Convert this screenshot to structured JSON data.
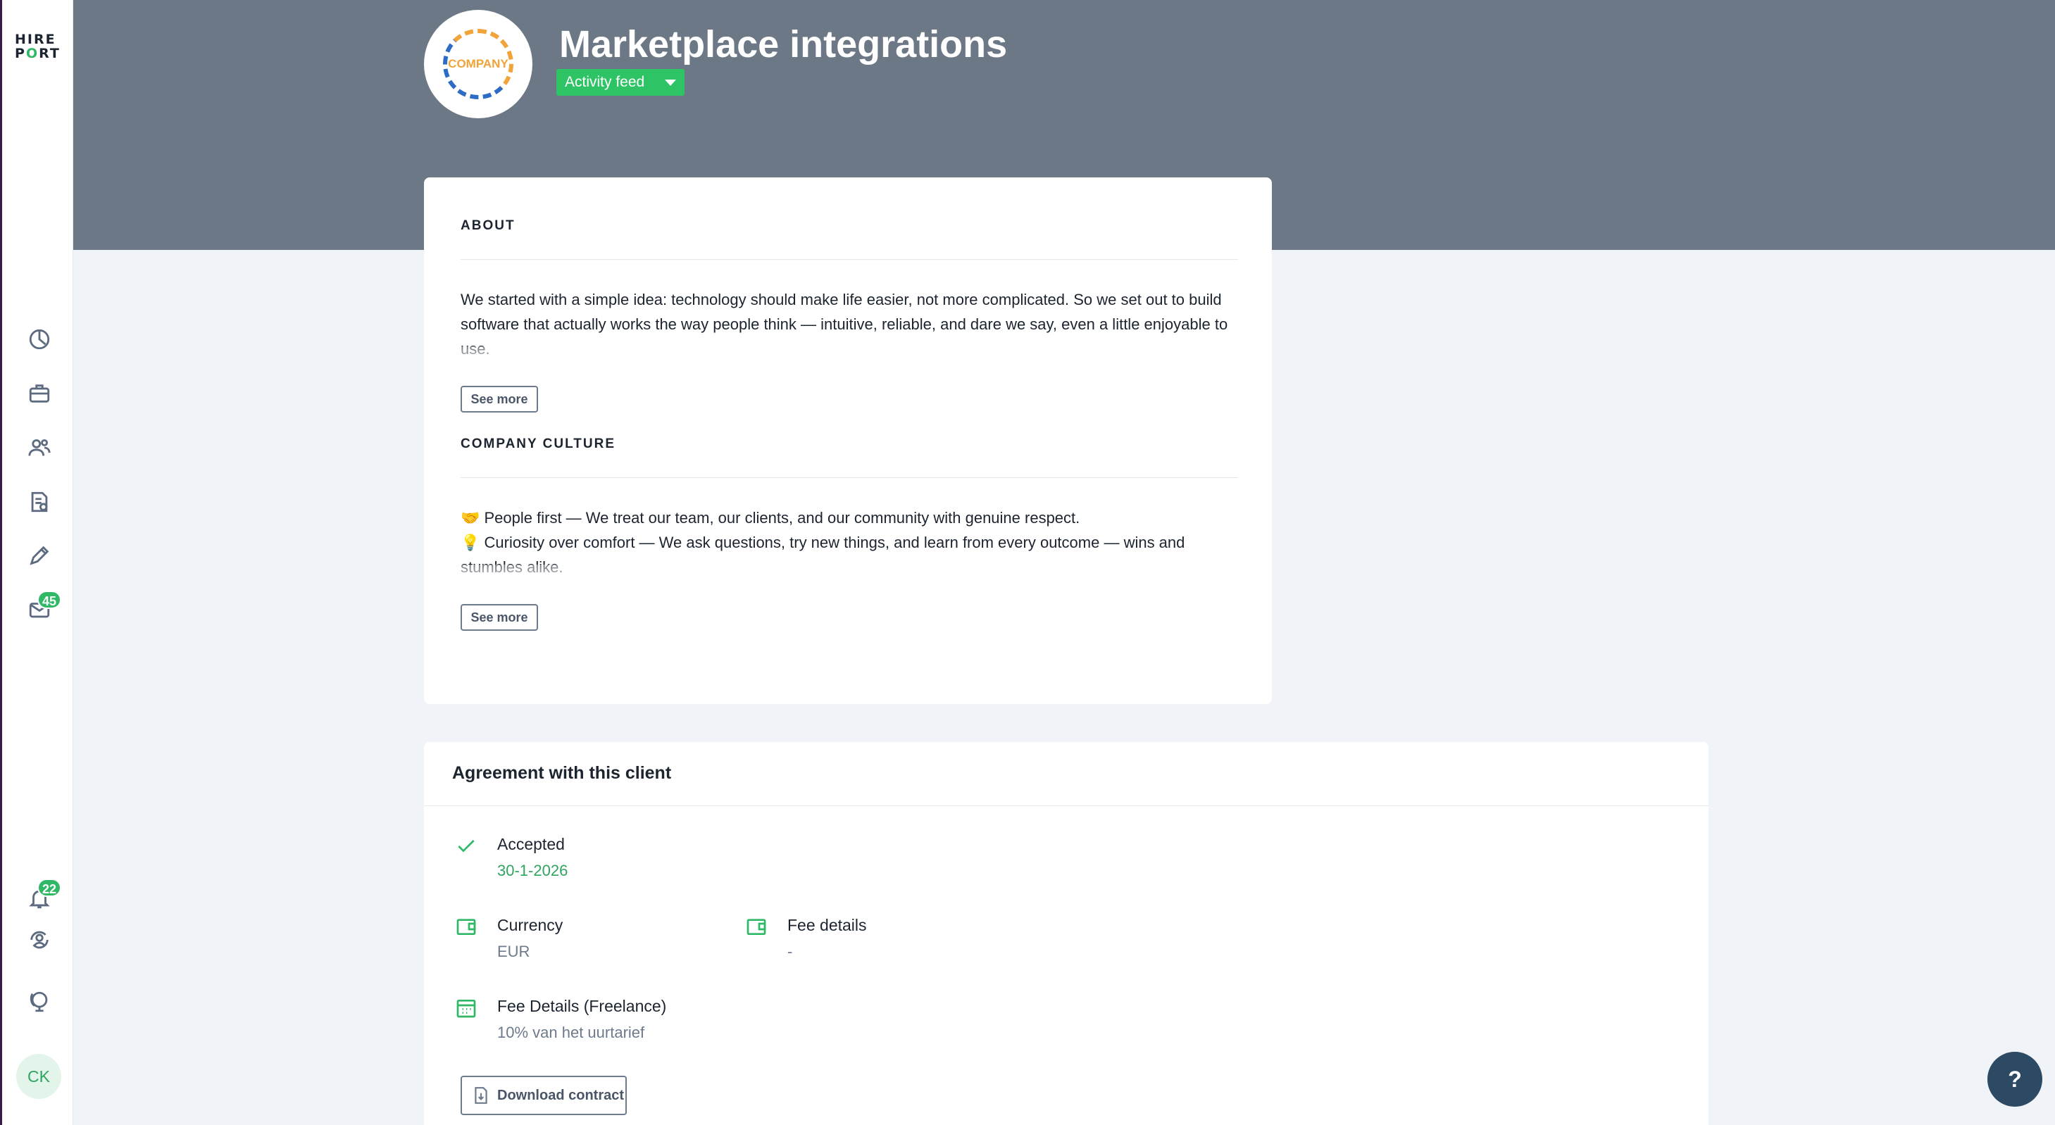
{
  "sidebar": {
    "logo_top": "HIRE",
    "logo_bottom_a": "P",
    "logo_bottom_o": "O",
    "logo_bottom_b": "RT",
    "items": [
      {
        "icon": "dashboard-icon"
      },
      {
        "icon": "briefcase-icon"
      },
      {
        "icon": "candidates-icon"
      },
      {
        "icon": "document-icon"
      },
      {
        "icon": "pencil-icon"
      },
      {
        "icon": "mail-icon",
        "badge": "45"
      }
    ],
    "bottom_items": [
      {
        "icon": "bell-icon",
        "badge": "22"
      },
      {
        "icon": "switch-account-icon"
      },
      {
        "icon": "globe-icon"
      }
    ],
    "avatar_initials": "CK"
  },
  "header": {
    "title": "Marketplace integrations",
    "company_logo_text": "COMPANY",
    "dropdown_label": "Activity feed"
  },
  "about": {
    "title": "ABOUT",
    "text": "We started with a simple idea: technology should make life easier, not more complicated. So we set out to build software that actually works the way people think — intuitive, reliable, and dare we say, even a little enjoyable to use.",
    "see_more": "See more"
  },
  "culture": {
    "title": "COMPANY CULTURE",
    "line1": "🤝 People first — We treat our team, our clients, and our community with genuine respect.",
    "line2": "💡 Curiosity over comfort — We ask questions, try new things, and learn from every outcome — wins and stumbles alike.",
    "see_more": "See more"
  },
  "agreement": {
    "title": "Agreement with this client",
    "accepted_label": "Accepted",
    "accepted_date": "30-1-2026",
    "currency_label": "Currency",
    "currency_value": "EUR",
    "fee_details_label": "Fee details",
    "fee_details_value": "-",
    "freelance_label": "Fee Details (Freelance)",
    "freelance_value": "10% van het uurtarief",
    "download_label": "Download contract"
  },
  "help_label": "?",
  "colors": {
    "accent_green": "#2ec466",
    "header_bg": "#6c7886",
    "help_bg": "#2c4a63"
  }
}
